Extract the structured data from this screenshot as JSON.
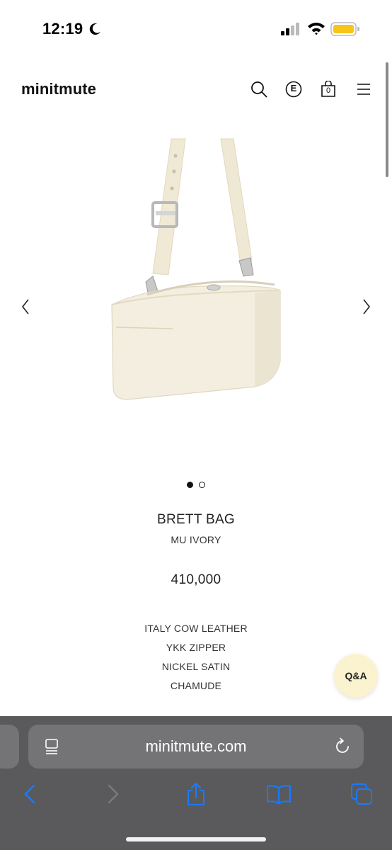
{
  "status_bar": {
    "time": "12:19"
  },
  "header": {
    "logo": "minitmute",
    "lang_label": "E",
    "cart_count": "0"
  },
  "gallery": {
    "active_index": 0,
    "total": 2
  },
  "product": {
    "name": "BRETT BAG",
    "color": "MU IVORY",
    "price": "410,000",
    "details": [
      "ITALY COW LEATHER",
      "YKK ZIPPER",
      "NICKEL SATIN",
      "CHAMUDE"
    ]
  },
  "qa_button": {
    "label": "Q&A"
  },
  "browser": {
    "url": "minitmute.com"
  },
  "colors": {
    "accent": "#1a7aff",
    "qa_bg": "#fbf3cf",
    "toolbar_bg": "#5a5a5c"
  }
}
